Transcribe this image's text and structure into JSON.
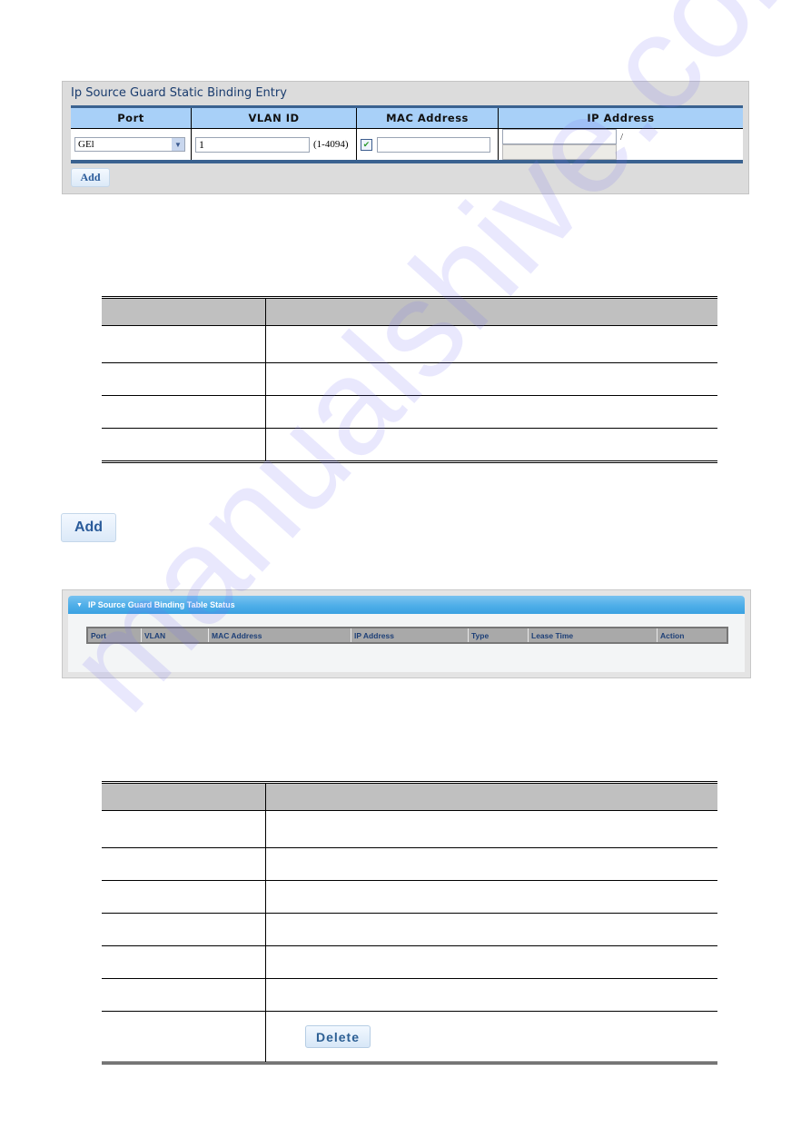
{
  "entry_panel": {
    "title": "Ip Source Guard Static Binding Entry",
    "columns": [
      "Port",
      "VLAN ID",
      "MAC Address",
      "IP Address"
    ],
    "port_select_value": "GEl",
    "vlan_id_value": "1",
    "vlan_range_hint": "(1-4094)",
    "mac_checkbox_checked": true,
    "mac_address_value": "",
    "ip_address_value": "",
    "ip_separator": "/",
    "ip_mask_value": "",
    "add_label": "Add"
  },
  "table1": {
    "header": [
      "",
      ""
    ],
    "rows": [
      [
        "",
        ""
      ],
      [
        "",
        ""
      ],
      [
        "",
        ""
      ],
      [
        "",
        ""
      ]
    ]
  },
  "add_button_large": {
    "label": "Add"
  },
  "status_panel": {
    "title": "IP Source Guard Binding Table Status",
    "columns": [
      "Port",
      "VLAN",
      "MAC Address",
      "IP Address",
      "Type",
      "Lease Time",
      "Action"
    ]
  },
  "table2": {
    "header": [
      "",
      ""
    ],
    "rows": [
      [
        "",
        ""
      ],
      [
        "",
        ""
      ],
      [
        "",
        ""
      ],
      [
        "",
        ""
      ],
      [
        "",
        ""
      ],
      [
        "",
        ""
      ],
      [
        "",
        ""
      ]
    ],
    "delete_label": "Delete"
  },
  "watermark": "manualshive.com",
  "colors": {
    "panel_header_blue": "#a8d0f8",
    "panel_border_blue": "#3a6290",
    "status_header_blue": "#4eaee8",
    "status_column_text": "#1d3f77",
    "button_text": "#2a5b9a"
  }
}
